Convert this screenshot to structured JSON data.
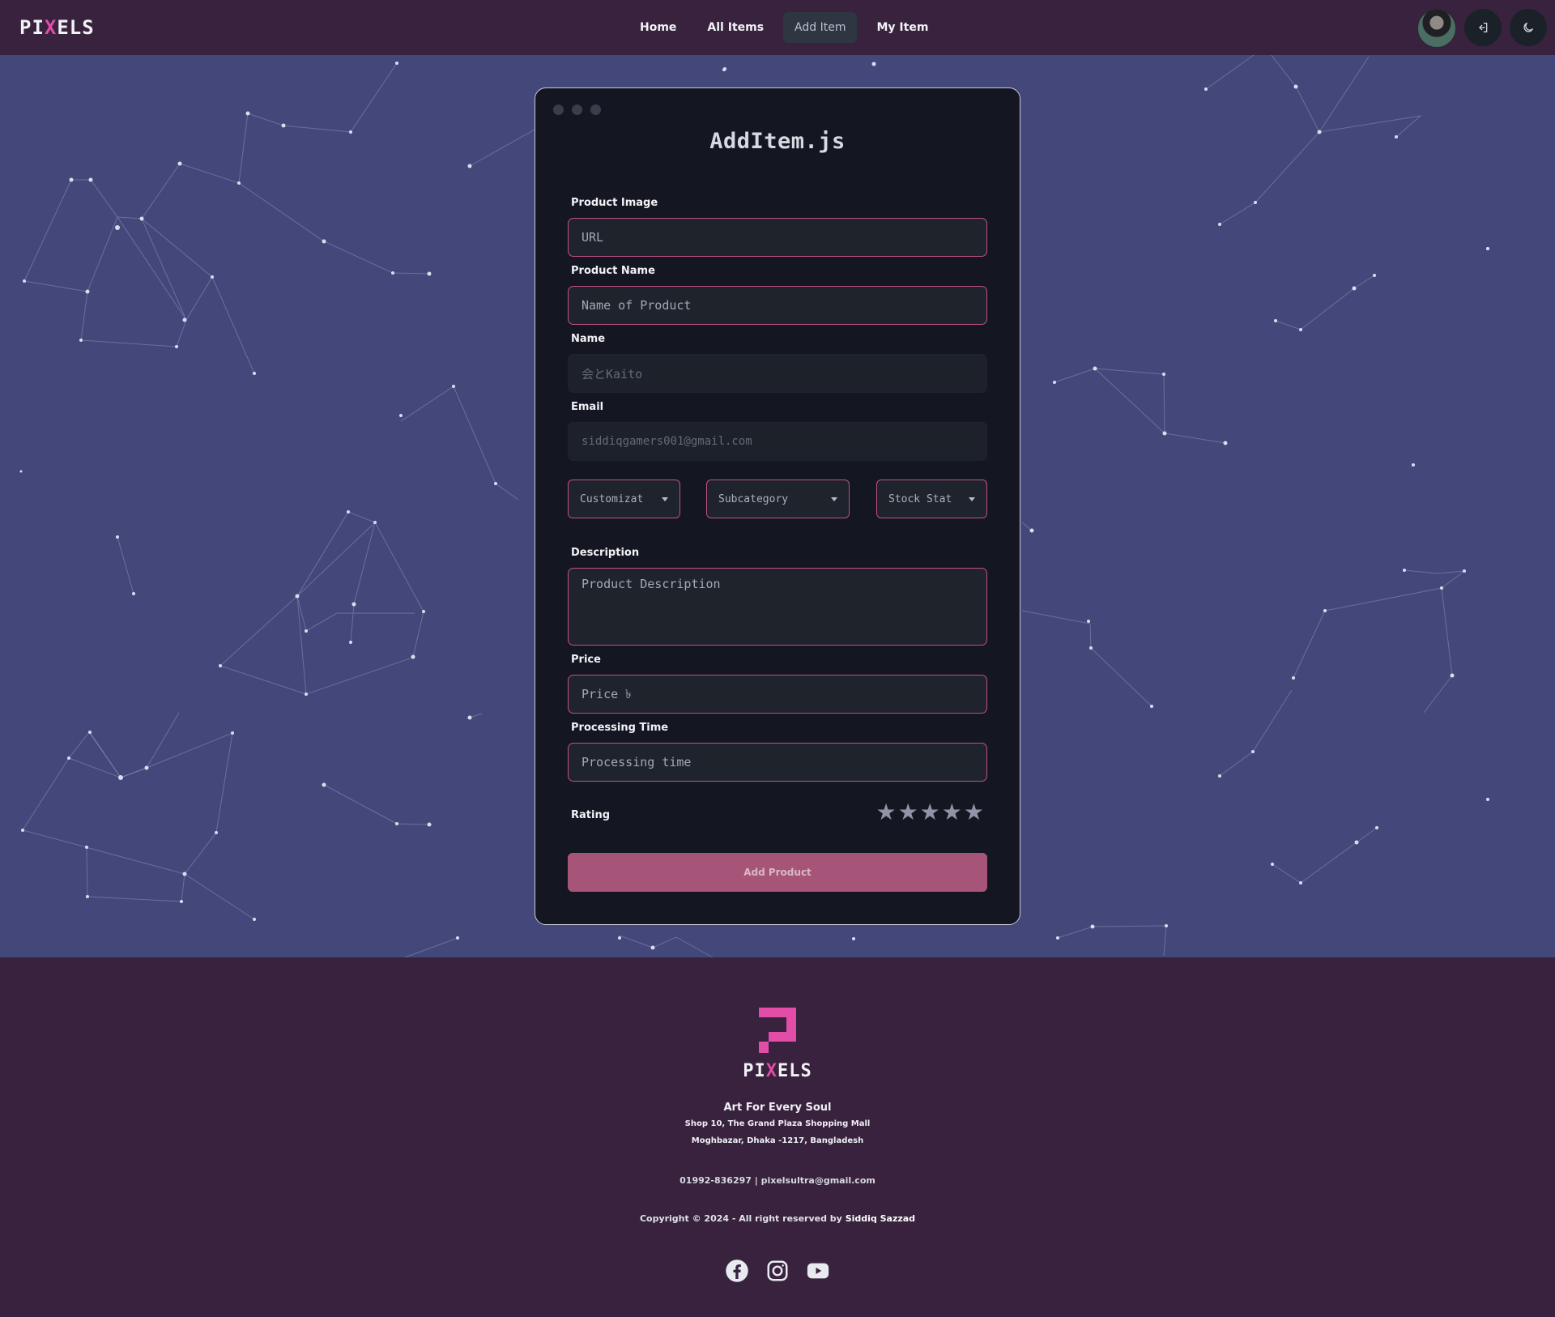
{
  "brand": {
    "logo_left": "PI",
    "logo_x": "X",
    "logo_right": "ELS"
  },
  "nav": {
    "links": [
      "Home",
      "All Items",
      "Add Item",
      "My Item"
    ],
    "active": "Add Item"
  },
  "colors": {
    "accent": "#e24da8",
    "field_border": "#c05082",
    "button": "#a65578",
    "nav_bg": "#38223d",
    "page_bg": "#44477a"
  },
  "icons": {
    "logout": "logout-icon",
    "theme": "moon-icon"
  },
  "form": {
    "title": "AddItem.js",
    "product_image": {
      "label": "Product Image",
      "placeholder": "URL"
    },
    "product_name": {
      "label": "Product Name",
      "placeholder": "Name of Product"
    },
    "name": {
      "label": "Name",
      "value": "会とKaito"
    },
    "email": {
      "label": "Email",
      "value": "siddiqgamers001@gmail.com"
    },
    "selects": {
      "customization": "Customizat",
      "subcategory": "Subcategory",
      "stock_status": "Stock Stat"
    },
    "description": {
      "label": "Description",
      "placeholder": "Product Description"
    },
    "price": {
      "label": "Price",
      "placeholder": "Price ৳"
    },
    "processing": {
      "label": "Processing Time",
      "placeholder": "Processing time"
    },
    "rating": {
      "label": "Rating",
      "value": 0,
      "max": 5
    },
    "submit": "Add Product"
  },
  "footer": {
    "logo_left": "PI",
    "logo_x": "X",
    "logo_right": "ELS",
    "tagline": "Art For Every Soul",
    "address1": "Shop 10, The Grand Plaza Shopping Mall",
    "address2": "Moghbazar, Dhaka -1217, Bangladesh",
    "contact": "01992-836297 | pixelsultra@gmail.com",
    "copyright": "Copyright © 2024 - All right reserved by",
    "author": "Siddiq Sazzad",
    "socials": [
      "facebook-icon",
      "instagram-icon",
      "youtube-icon"
    ]
  }
}
